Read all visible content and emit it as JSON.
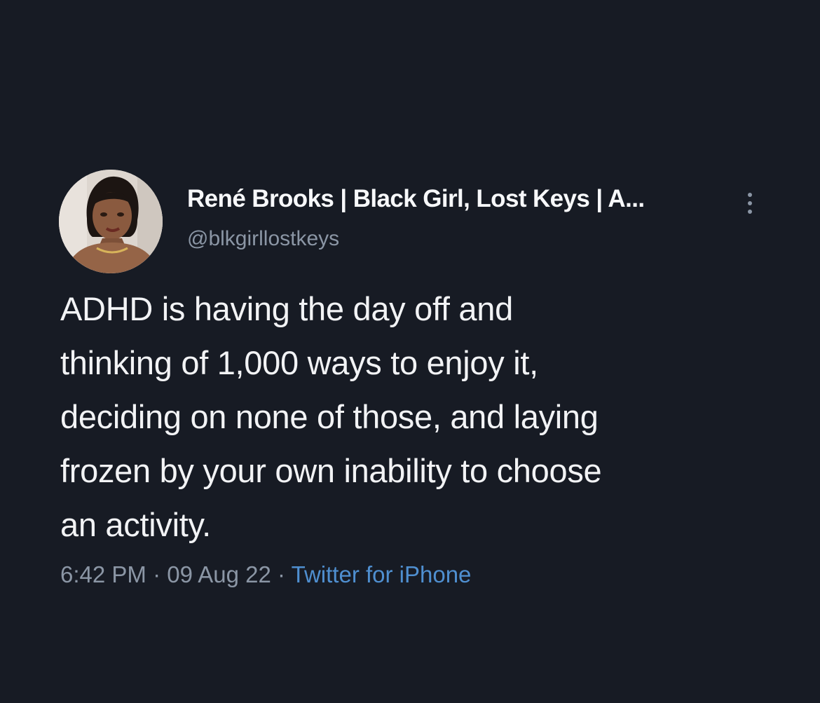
{
  "tweet": {
    "author": {
      "display_name": "René Brooks | Black Girl, Lost Keys | A...",
      "handle": "@blkgirllostkeys",
      "avatar_icon": "profile-photo"
    },
    "more_icon": "vertical-ellipsis-icon",
    "text_lines": [
      "ADHD is having the day off and",
      "thinking of 1,000 ways to enjoy it,",
      "deciding on none of those, and laying",
      "frozen by your own inability to choose",
      "an activity."
    ],
    "meta": {
      "time": "6:42 PM",
      "separator": " · ",
      "date": "09 Aug 22",
      "source": "Twitter for iPhone"
    }
  },
  "colors": {
    "background": "#171b24",
    "text": "#f2f3f5",
    "secondary_text": "#8b96a5",
    "link": "#4f8fd0"
  }
}
